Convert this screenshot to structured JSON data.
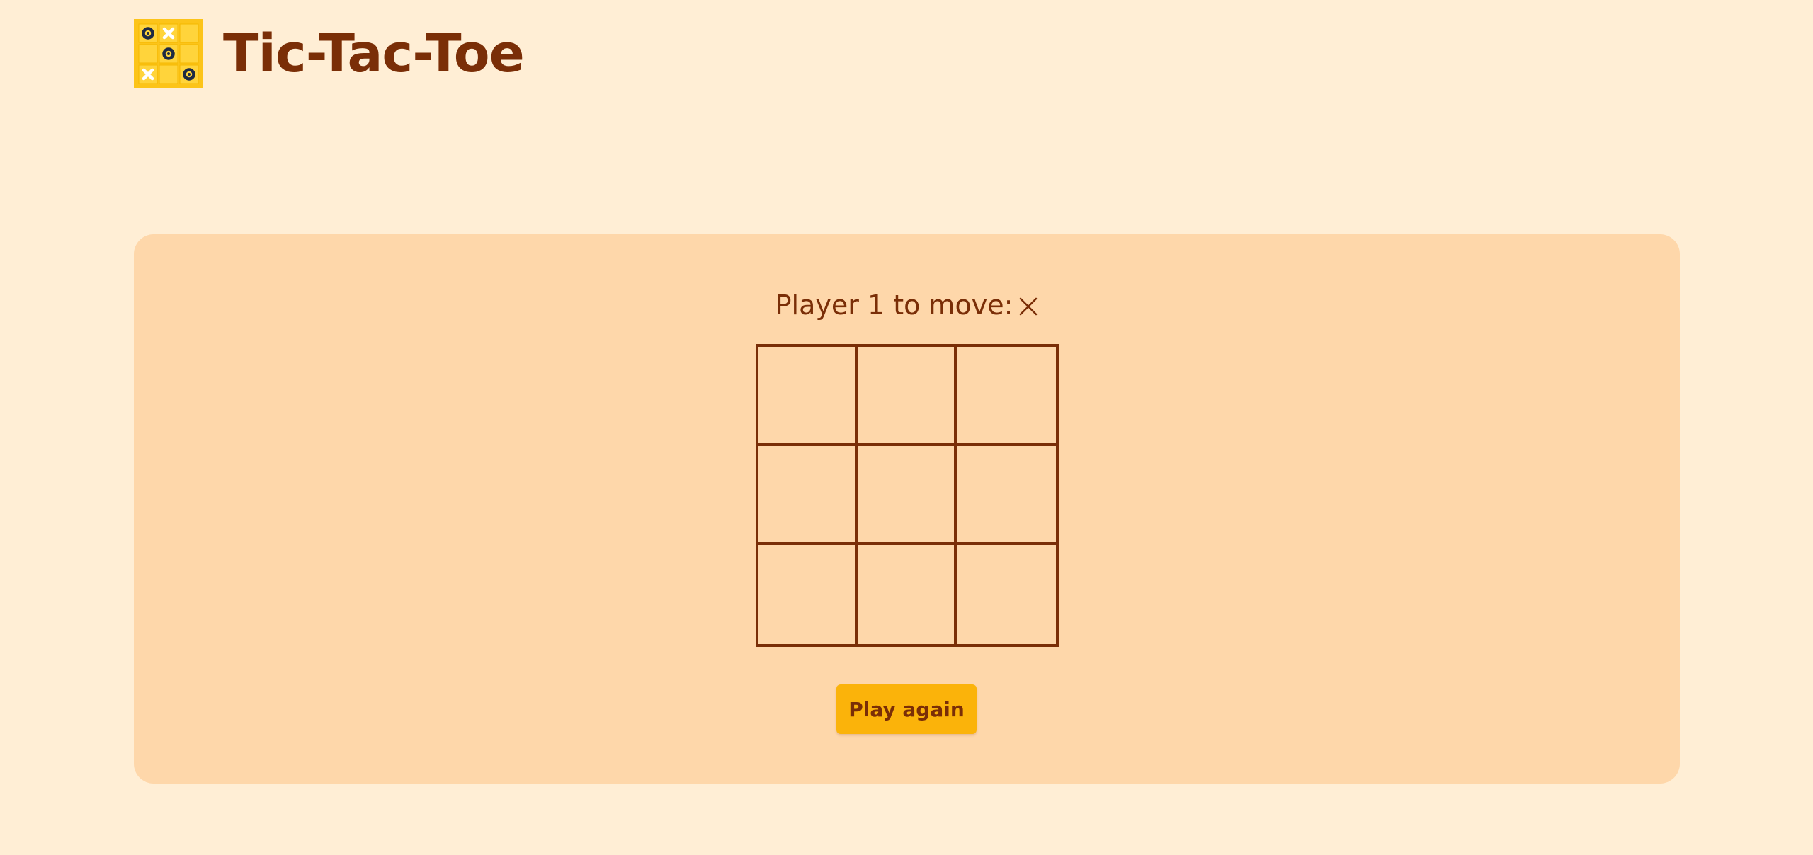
{
  "app": {
    "title": "Tic-Tac-Toe",
    "logo_icon": "tic-tac-toe-logo-icon"
  },
  "colors": {
    "page_background": "#ffeed5",
    "panel_background": "#fed7aa",
    "text": "#7a2e07",
    "accent": "#fbb30a",
    "logo_tile": "#fcc419",
    "logo_cell": "#ffd43b",
    "logo_o": "#1e2a44",
    "logo_x": "#ffffff"
  },
  "game": {
    "status_label": "Player 1 to move:",
    "current_mark": "×",
    "current_mark_icon": "x-mark-icon",
    "board": [
      [
        "",
        "",
        ""
      ],
      [
        "",
        "",
        ""
      ],
      [
        "",
        "",
        ""
      ]
    ],
    "play_again_label": "Play again"
  }
}
